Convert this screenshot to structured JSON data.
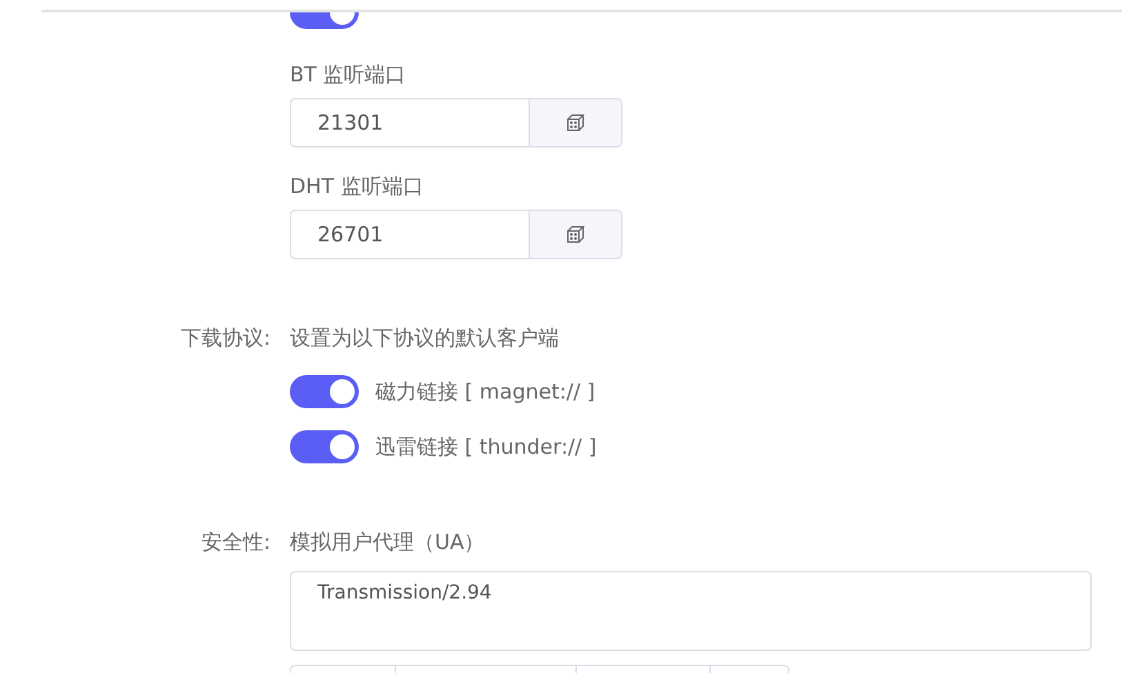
{
  "sections": [
    {
      "items": [
        {
          "kind": "cut_toggle",
          "on": true
        },
        {
          "kind": "port",
          "label": "BT 监听端口",
          "value": "21301"
        },
        {
          "kind": "port",
          "label": "DHT 监听端口",
          "value": "26701"
        }
      ]
    },
    {
      "label": "下载协议:",
      "items": [
        {
          "kind": "note",
          "text": "设置为以下协议的默认客户端"
        },
        {
          "kind": "toggle",
          "on": true,
          "text": "磁力链接 [ magnet:// ]"
        },
        {
          "kind": "toggle",
          "on": true,
          "text": "迅雷链接 [ thunder:// ]"
        }
      ]
    },
    {
      "label": "安全性:",
      "items": [
        {
          "kind": "note",
          "text": "模拟用户代理（UA）"
        },
        {
          "kind": "textarea",
          "value": "Transmission/2.94"
        },
        {
          "kind": "segments"
        }
      ]
    }
  ]
}
